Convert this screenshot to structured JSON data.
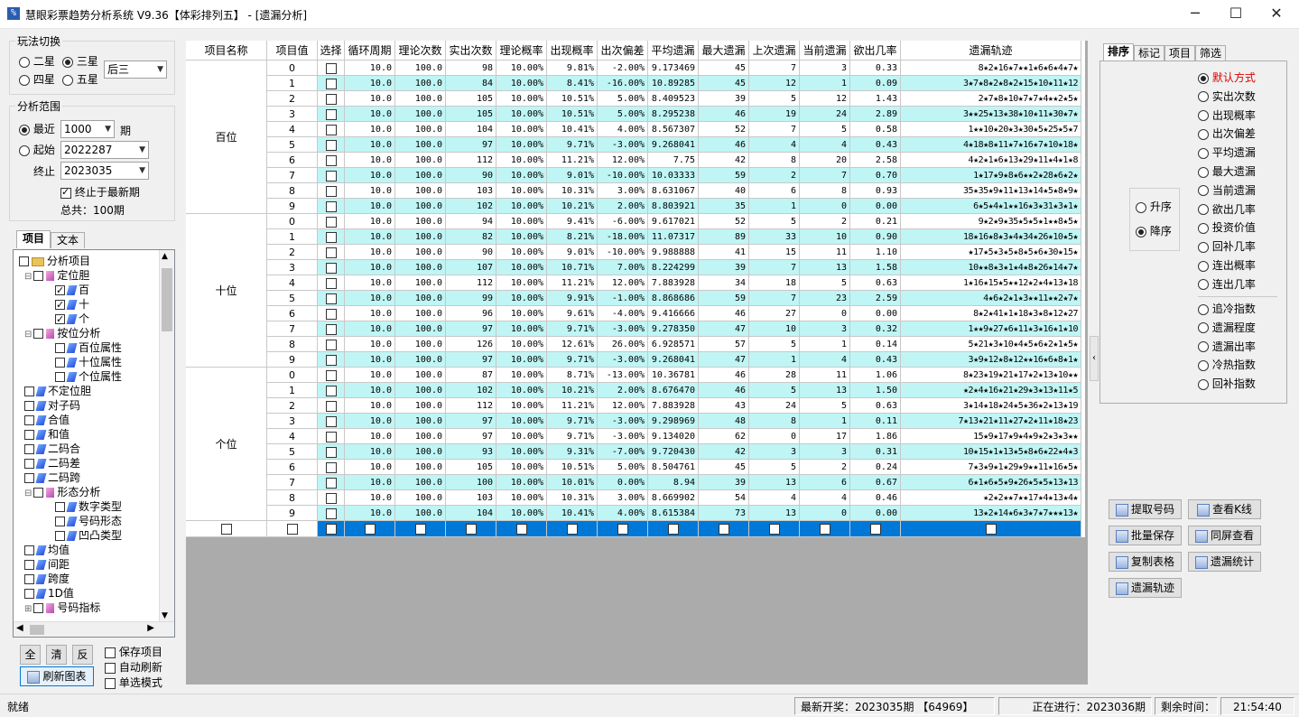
{
  "window": {
    "icon_text": "%",
    "title": "慧眼彩票趋势分析系统 V9.36【体彩排列五】 - [遗漏分析]",
    "minimize": "─",
    "maximize": "☐",
    "close": "✕"
  },
  "play_switch": {
    "title": "玩法切换",
    "options": [
      "二星",
      "三星",
      "四星",
      "五星"
    ],
    "selected": "三星",
    "combo_value": "后三"
  },
  "range": {
    "title": "分析范围",
    "recent_label": "最近",
    "recent_value": "1000",
    "period_unit": "期",
    "start_label": "起始",
    "start_value": "2022287",
    "end_label": "终止",
    "end_value": "2023035",
    "latest_check_label": "终止于最新期",
    "total_label": "总共：100期",
    "selected": "最近"
  },
  "left_tabs": [
    "项目",
    "文本"
  ],
  "tree": [
    {
      "label": "分析项目",
      "level": 0,
      "icon": "folder-icon",
      "checked": false,
      "expander": ""
    },
    {
      "label": "定位胆",
      "level": 1,
      "icon": "pink",
      "checked": false,
      "expander": "⊟"
    },
    {
      "label": "百",
      "level": 2,
      "icon": "gem",
      "checked": true,
      "expander": ""
    },
    {
      "label": "十",
      "level": 2,
      "icon": "gem",
      "checked": true,
      "expander": ""
    },
    {
      "label": "个",
      "level": 2,
      "icon": "gem",
      "checked": true,
      "expander": ""
    },
    {
      "label": "按位分析",
      "level": 1,
      "icon": "pink",
      "checked": false,
      "expander": "⊟"
    },
    {
      "label": "百位属性",
      "level": 2,
      "icon": "gem",
      "checked": false,
      "expander": ""
    },
    {
      "label": "十位属性",
      "level": 2,
      "icon": "gem",
      "checked": false,
      "expander": ""
    },
    {
      "label": "个位属性",
      "level": 2,
      "icon": "gem",
      "checked": false,
      "expander": ""
    },
    {
      "label": "不定位胆",
      "level": 1,
      "icon": "gem",
      "checked": false,
      "expander": ""
    },
    {
      "label": "对子码",
      "level": 1,
      "icon": "gem",
      "checked": false,
      "expander": ""
    },
    {
      "label": "合值",
      "level": 1,
      "icon": "gem",
      "checked": false,
      "expander": ""
    },
    {
      "label": "和值",
      "level": 1,
      "icon": "gem",
      "checked": false,
      "expander": ""
    },
    {
      "label": "二码合",
      "level": 1,
      "icon": "gem",
      "checked": false,
      "expander": ""
    },
    {
      "label": "二码差",
      "level": 1,
      "icon": "gem",
      "checked": false,
      "expander": ""
    },
    {
      "label": "二码跨",
      "level": 1,
      "icon": "gem",
      "checked": false,
      "expander": ""
    },
    {
      "label": "形态分析",
      "level": 1,
      "icon": "pink",
      "checked": false,
      "expander": "⊟"
    },
    {
      "label": "数字类型",
      "level": 2,
      "icon": "gem",
      "checked": false,
      "expander": ""
    },
    {
      "label": "号码形态",
      "level": 2,
      "icon": "gem",
      "checked": false,
      "expander": ""
    },
    {
      "label": "凹凸类型",
      "level": 2,
      "icon": "gem",
      "checked": false,
      "expander": ""
    },
    {
      "label": "均值",
      "level": 1,
      "icon": "gem",
      "checked": false,
      "expander": ""
    },
    {
      "label": "间距",
      "level": 1,
      "icon": "gem",
      "checked": false,
      "expander": ""
    },
    {
      "label": "跨度",
      "level": 1,
      "icon": "gem",
      "checked": false,
      "expander": ""
    },
    {
      "label": "1D值",
      "level": 1,
      "icon": "gem",
      "checked": false,
      "expander": ""
    },
    {
      "label": "号码指标",
      "level": 1,
      "icon": "pink",
      "checked": false,
      "expander": "⊞"
    }
  ],
  "bottom_left": {
    "btn_all": "全",
    "btn_clear": "清",
    "btn_invert": "反",
    "save_item": "保存项目",
    "auto_refresh": "自动刷新",
    "single_mode": "单选模式",
    "refresh_chart": "刷新图表"
  },
  "table": {
    "headers": [
      "项目名称",
      "项目值",
      "选择",
      "循环周期",
      "理论次数",
      "实出次数",
      "理论概率",
      "出现概率",
      "出次偏差",
      "平均遗漏",
      "最大遗漏",
      "上次遗漏",
      "当前遗漏",
      "欲出几率",
      "遗漏轨迹"
    ],
    "groups": [
      "百位",
      "十位",
      "个位"
    ],
    "rows": [
      [
        "0",
        "10.0",
        "100.0",
        "98",
        "10.00%",
        "9.81%",
        "-2.00%",
        "9.173469",
        "45",
        "7",
        "3",
        "0.33",
        "8★2★16★7★★1★6★6★4★7★"
      ],
      [
        "1",
        "10.0",
        "100.0",
        "84",
        "10.00%",
        "8.41%",
        "-16.00%",
        "10.89285",
        "45",
        "12",
        "1",
        "0.09",
        "3★7★8★2★8★2★15★10★11★12"
      ],
      [
        "2",
        "10.0",
        "100.0",
        "105",
        "10.00%",
        "10.51%",
        "5.00%",
        "8.409523",
        "39",
        "5",
        "12",
        "1.43",
        "2★7★8★10★7★7★4★★2★5★"
      ],
      [
        "3",
        "10.0",
        "100.0",
        "105",
        "10.00%",
        "10.51%",
        "5.00%",
        "8.295238",
        "46",
        "19",
        "24",
        "2.89",
        "3★★25★13★38★10★11★30★7★"
      ],
      [
        "4",
        "10.0",
        "100.0",
        "104",
        "10.00%",
        "10.41%",
        "4.00%",
        "8.567307",
        "52",
        "7",
        "5",
        "0.58",
        "1★★10★20★3★30★5★25★5★7"
      ],
      [
        "5",
        "10.0",
        "100.0",
        "97",
        "10.00%",
        "9.71%",
        "-3.00%",
        "9.268041",
        "46",
        "4",
        "4",
        "0.43",
        "4★18★8★11★7★16★7★10★18★"
      ],
      [
        "6",
        "10.0",
        "100.0",
        "112",
        "10.00%",
        "11.21%",
        "12.00%",
        "7.75",
        "42",
        "8",
        "20",
        "2.58",
        "4★2★1★6★13★29★11★4★1★8"
      ],
      [
        "7",
        "10.0",
        "100.0",
        "90",
        "10.00%",
        "9.01%",
        "-10.00%",
        "10.03333",
        "59",
        "2",
        "7",
        "0.70",
        "1★17★9★8★6★★2★28★6★2★"
      ],
      [
        "8",
        "10.0",
        "100.0",
        "103",
        "10.00%",
        "10.31%",
        "3.00%",
        "8.631067",
        "40",
        "6",
        "8",
        "0.93",
        "35★35★9★11★13★14★5★8★9★"
      ],
      [
        "9",
        "10.0",
        "100.0",
        "102",
        "10.00%",
        "10.21%",
        "2.00%",
        "8.803921",
        "35",
        "1",
        "0",
        "0.00",
        "6★5★4★1★★16★3★31★3★1★"
      ],
      [
        "0",
        "10.0",
        "100.0",
        "94",
        "10.00%",
        "9.41%",
        "-6.00%",
        "9.617021",
        "52",
        "5",
        "2",
        "0.21",
        "9★2★9★35★5★5★1★★8★5★"
      ],
      [
        "1",
        "10.0",
        "100.0",
        "82",
        "10.00%",
        "8.21%",
        "-18.00%",
        "11.07317",
        "89",
        "33",
        "10",
        "0.90",
        "18★16★8★3★4★34★26★10★5★"
      ],
      [
        "2",
        "10.0",
        "100.0",
        "90",
        "10.00%",
        "9.01%",
        "-10.00%",
        "9.988888",
        "41",
        "15",
        "11",
        "1.10",
        "★17★5★3★5★8★5★6★30★15★"
      ],
      [
        "3",
        "10.0",
        "100.0",
        "107",
        "10.00%",
        "10.71%",
        "7.00%",
        "8.224299",
        "39",
        "7",
        "13",
        "1.58",
        "10★★8★3★1★4★8★26★14★7★"
      ],
      [
        "4",
        "10.0",
        "100.0",
        "112",
        "10.00%",
        "11.21%",
        "12.00%",
        "7.883928",
        "34",
        "18",
        "5",
        "0.63",
        "1★16★15★5★★12★2★4★13★18"
      ],
      [
        "5",
        "10.0",
        "100.0",
        "99",
        "10.00%",
        "9.91%",
        "-1.00%",
        "8.868686",
        "59",
        "7",
        "23",
        "2.59",
        "4★6★2★1★3★★11★★2★7★"
      ],
      [
        "6",
        "10.0",
        "100.0",
        "96",
        "10.00%",
        "9.61%",
        "-4.00%",
        "9.416666",
        "46",
        "27",
        "0",
        "0.00",
        "8★2★41★1★18★3★8★12★27"
      ],
      [
        "7",
        "10.0",
        "100.0",
        "97",
        "10.00%",
        "9.71%",
        "-3.00%",
        "9.278350",
        "47",
        "10",
        "3",
        "0.32",
        "1★★9★27★6★11★3★16★1★10"
      ],
      [
        "8",
        "10.0",
        "100.0",
        "126",
        "10.00%",
        "12.61%",
        "26.00%",
        "6.928571",
        "57",
        "5",
        "1",
        "0.14",
        "5★21★3★10★4★5★6★2★1★5★"
      ],
      [
        "9",
        "10.0",
        "100.0",
        "97",
        "10.00%",
        "9.71%",
        "-3.00%",
        "9.268041",
        "47",
        "1",
        "4",
        "0.43",
        "3★9★12★8★12★★16★6★8★1★"
      ],
      [
        "0",
        "10.0",
        "100.0",
        "87",
        "10.00%",
        "8.71%",
        "-13.00%",
        "10.36781",
        "46",
        "28",
        "11",
        "1.06",
        "8★23★19★21★17★2★13★10★★"
      ],
      [
        "1",
        "10.0",
        "100.0",
        "102",
        "10.00%",
        "10.21%",
        "2.00%",
        "8.676470",
        "46",
        "5",
        "13",
        "1.50",
        "★2★4★16★21★29★3★13★11★5"
      ],
      [
        "2",
        "10.0",
        "100.0",
        "112",
        "10.00%",
        "11.21%",
        "12.00%",
        "7.883928",
        "43",
        "24",
        "5",
        "0.63",
        "3★14★18★24★5★36★2★13★19"
      ],
      [
        "3",
        "10.0",
        "100.0",
        "97",
        "10.00%",
        "9.71%",
        "-3.00%",
        "9.298969",
        "48",
        "8",
        "1",
        "0.11",
        "7★13★21★11★27★2★11★18★23"
      ],
      [
        "4",
        "10.0",
        "100.0",
        "97",
        "10.00%",
        "9.71%",
        "-3.00%",
        "9.134020",
        "62",
        "0",
        "17",
        "1.86",
        "15★9★17★9★4★9★2★3★3★★"
      ],
      [
        "5",
        "10.0",
        "100.0",
        "93",
        "10.00%",
        "9.31%",
        "-7.00%",
        "9.720430",
        "42",
        "3",
        "3",
        "0.31",
        "10★15★1★13★5★8★6★22★4★3"
      ],
      [
        "6",
        "10.0",
        "100.0",
        "105",
        "10.00%",
        "10.51%",
        "5.00%",
        "8.504761",
        "45",
        "5",
        "2",
        "0.24",
        "7★3★9★1★29★9★★11★16★5★"
      ],
      [
        "7",
        "10.0",
        "100.0",
        "100",
        "10.00%",
        "10.01%",
        "0.00%",
        "8.94",
        "39",
        "13",
        "6",
        "0.67",
        "6★1★6★5★9★26★5★5★13★13"
      ],
      [
        "8",
        "10.0",
        "100.0",
        "103",
        "10.00%",
        "10.31%",
        "3.00%",
        "8.669902",
        "54",
        "4",
        "4",
        "0.46",
        "★2★2★★7★★17★4★13★4★"
      ],
      [
        "9",
        "10.0",
        "100.0",
        "104",
        "10.00%",
        "10.41%",
        "4.00%",
        "8.615384",
        "73",
        "13",
        "0",
        "0.00",
        "13★2★14★6★3★7★7★★★13★"
      ]
    ]
  },
  "right_tabs": [
    "排序",
    "标记",
    "项目",
    "筛选"
  ],
  "sort_direction": {
    "asc": "升序",
    "desc": "降序",
    "selected": "降序"
  },
  "sort_options": [
    "默认方式",
    "实出次数",
    "出现概率",
    "出次偏差",
    "平均遗漏",
    "最大遗漏",
    "当前遗漏",
    "欲出几率",
    "投资价值",
    "回补几率",
    "连出概率",
    "连出几率"
  ],
  "sort_options2": [
    "追冷指数",
    "遗漏程度",
    "遗漏出率",
    "冷热指数",
    "回补指数"
  ],
  "sort_selected": "默认方式",
  "accent_color": "#e00000",
  "row_cyan": "#bff5f5",
  "selection_color": "#0078d7",
  "action_buttons": [
    {
      "label": "提取号码",
      "icon": "extract-icon"
    },
    {
      "label": "查看K线",
      "icon": "kline-icon"
    },
    {
      "label": "批量保存",
      "icon": "batch-save-icon"
    },
    {
      "label": "同屏查看",
      "icon": "same-screen-icon"
    },
    {
      "label": "复制表格",
      "icon": "copy-table-icon"
    },
    {
      "label": "遗漏统计",
      "icon": "stats-icon"
    },
    {
      "label": "遗漏轨迹",
      "icon": "track-icon"
    }
  ],
  "status": {
    "ready": "就绪",
    "latest": "最新开奖：2023035期 【64969】",
    "ongoing": "正在进行：2023036期",
    "remaining_label": "剩余时间：",
    "remaining_value": "21:54:40"
  }
}
